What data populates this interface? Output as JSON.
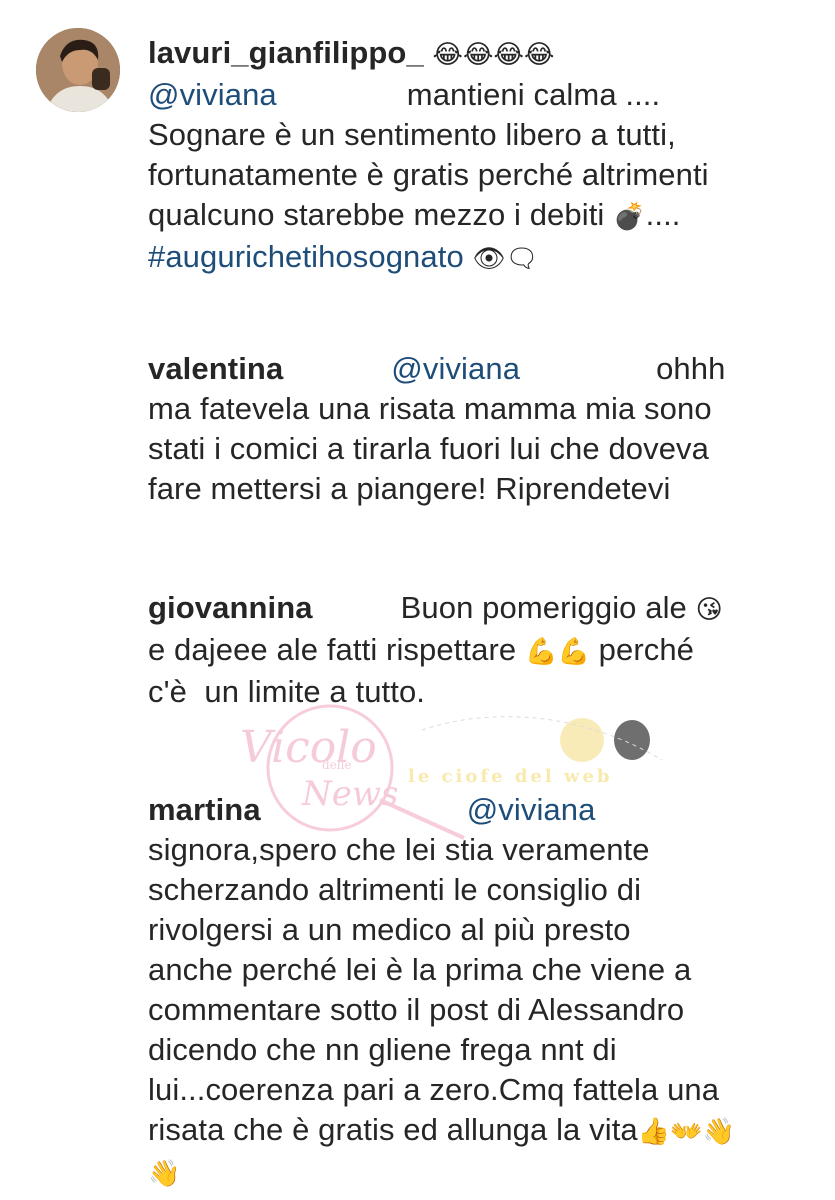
{
  "comments": [
    {
      "username": "lavuri_gianfilippo_",
      "username_emoji": "😂😂😂😂",
      "mention": "@viviana",
      "lines": [
        "mantieni calma ....",
        "Sognare è un sentimento libero a tutti,",
        "fortunatamente è gratis perché altrimenti",
        "qualcuno starebbe mezzo i debiti"
      ],
      "line4_emoji": "💣",
      "line4_tail": "....",
      "hashtag": "#augurichetihosognato",
      "hashtag_emoji": "👁🗨"
    },
    {
      "username": "valentina",
      "mention": "@viviana",
      "first_text": "ohhh",
      "lines": [
        "ma fatevela una risata mamma mia sono",
        "stati i comici a tirarla fuori lui che doveva",
        "fare mettersi a piangere! Riprendetevi"
      ]
    },
    {
      "username": "giovannina",
      "first_text": "Buon pomeriggio ale",
      "first_emoji": "😘",
      "line2_text": "e dajeee ale fatti rispettare",
      "line2_emoji": "💪💪",
      "line2_tail": "perché",
      "line3": "c'è  un limite a tutto."
    },
    {
      "username": "martina",
      "mention": "@viviana",
      "lines": [
        "signora,spero che lei stia veramente",
        "scherzando altrimenti le consiglio di",
        "rivolgersi a un medico al più presto",
        "anche perché lei è la prima che viene a",
        "commentare sotto il post di Alessandro",
        "dicendo che nn gliene frega nnt di",
        "lui...coerenza pari a zero.Cmq fattela una",
        "risata che è gratis ed allunga la vita"
      ],
      "last_emoji": "👍👐👋",
      "final_emoji": "👋"
    }
  ],
  "watermark": {
    "title": "Vicolo",
    "small": "delle",
    "word": "News",
    "right": "le ciofe del web"
  }
}
